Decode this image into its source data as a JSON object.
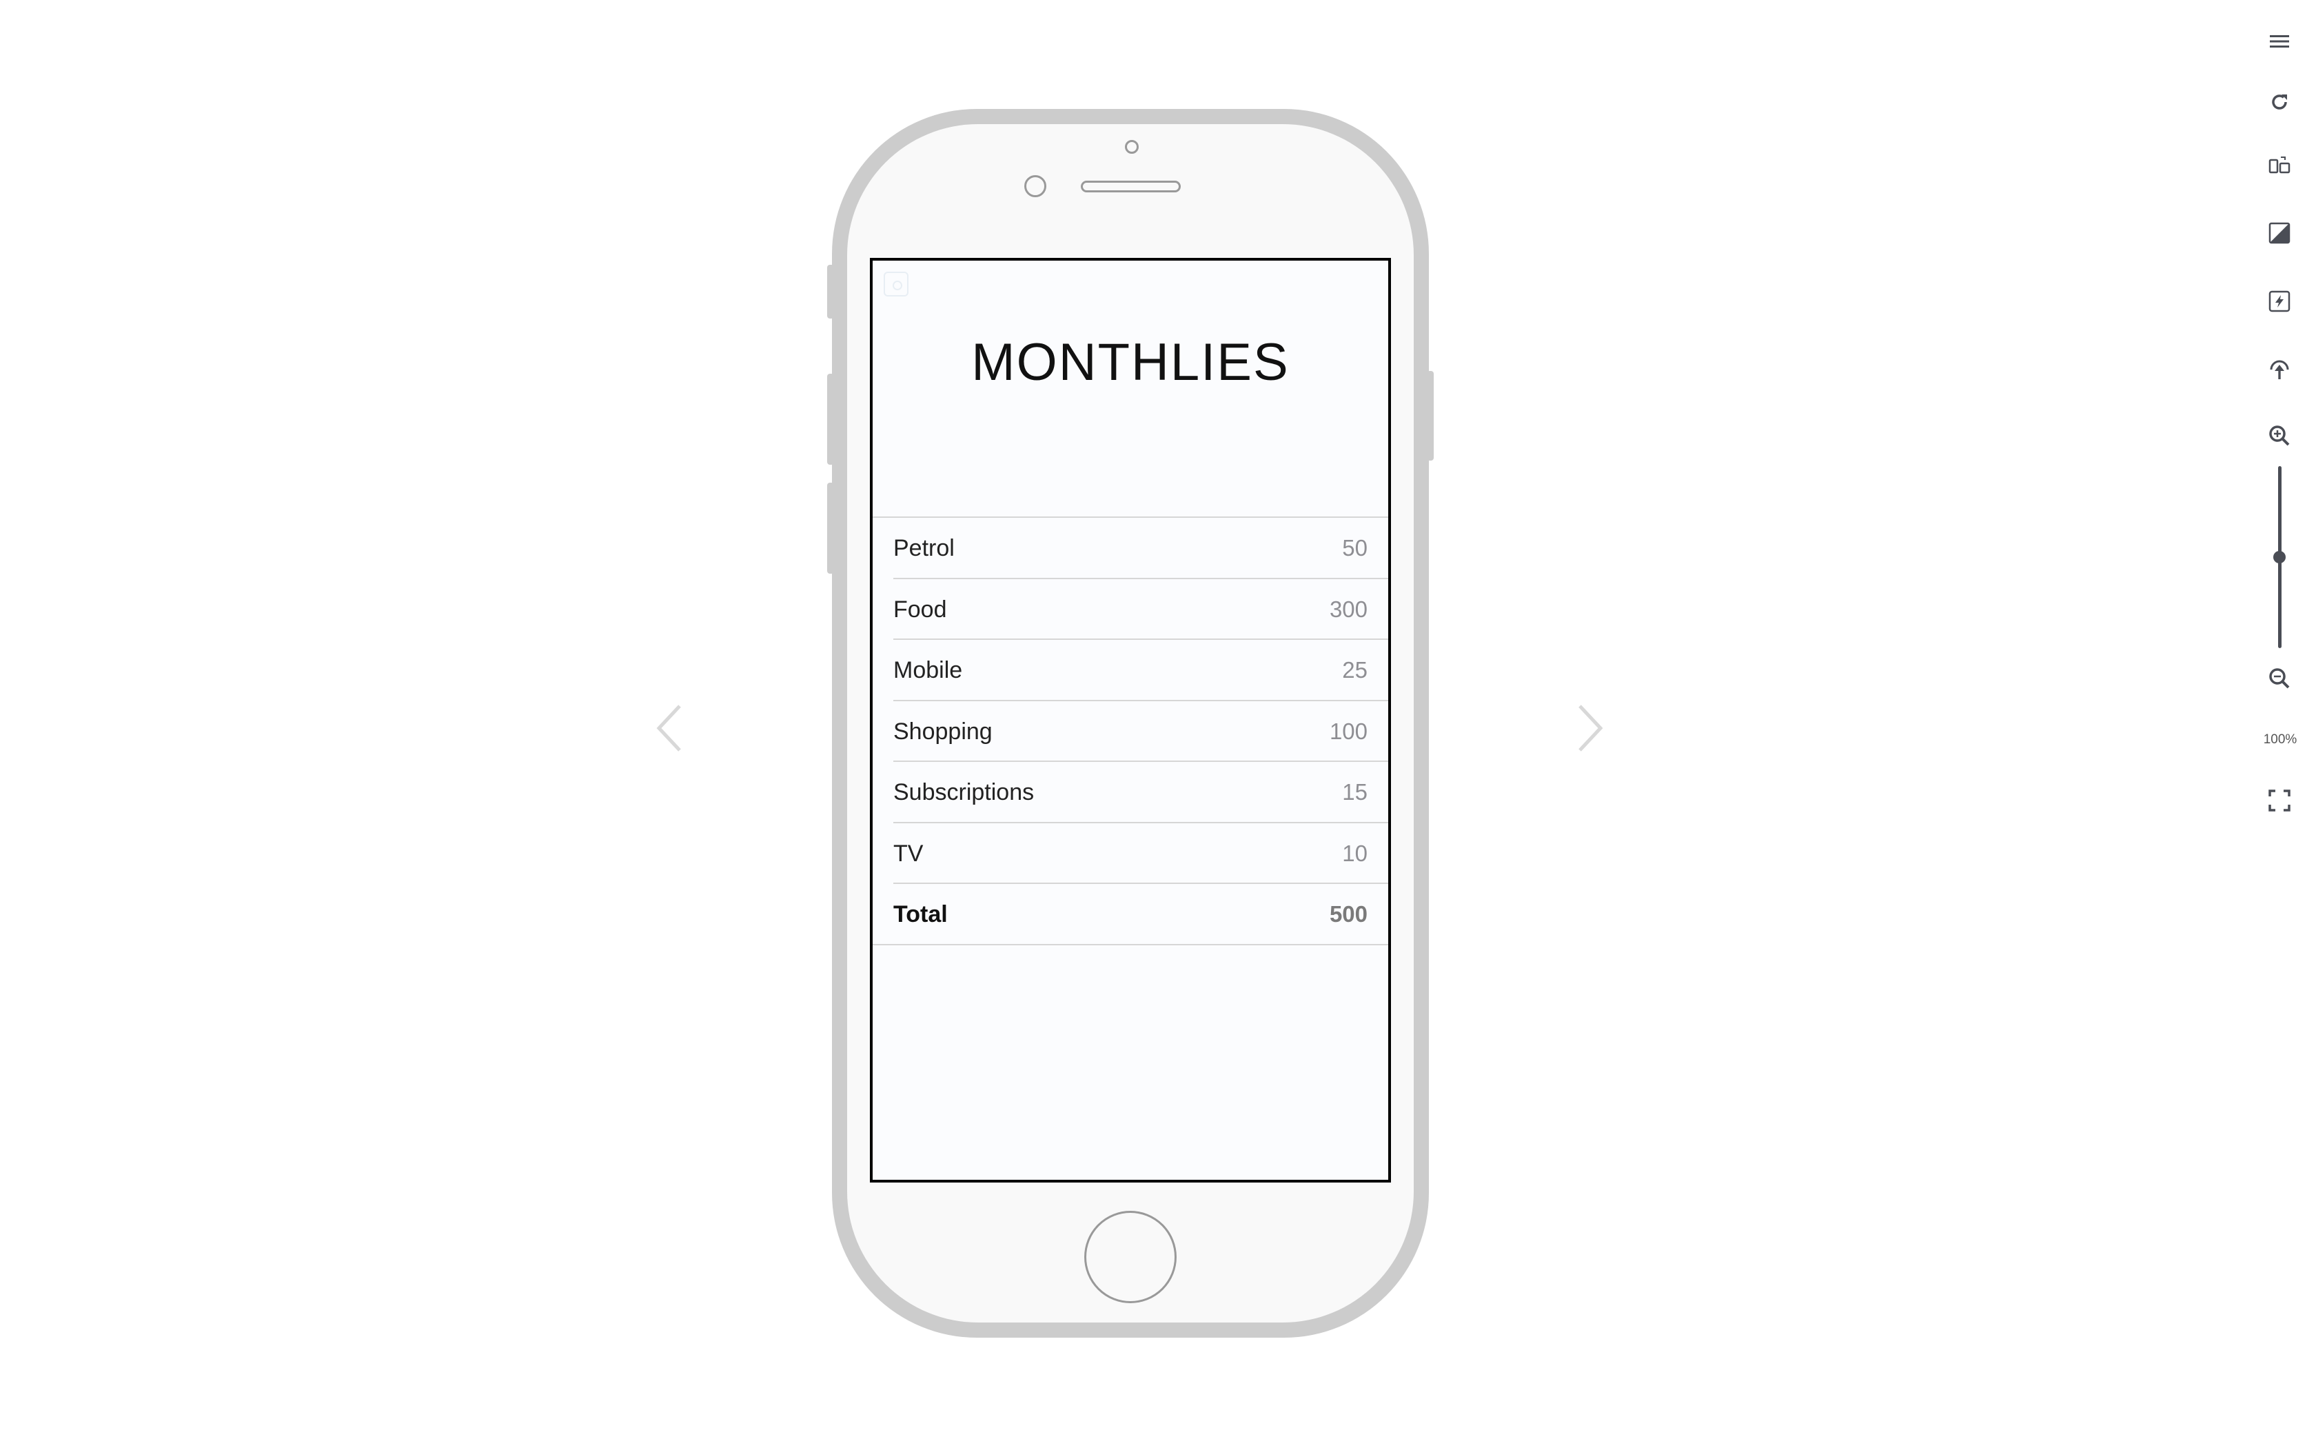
{
  "screen": {
    "title": "MONTHLIES",
    "items": [
      {
        "label": "Petrol",
        "value": "50"
      },
      {
        "label": "Food",
        "value": "300"
      },
      {
        "label": "Mobile",
        "value": "25"
      },
      {
        "label": "Shopping",
        "value": "100"
      },
      {
        "label": "Subscriptions",
        "value": "15"
      },
      {
        "label": "TV",
        "value": "10"
      }
    ],
    "total": {
      "label": "Total",
      "value": "500"
    }
  },
  "toolbar": {
    "icons": [
      "menu-icon",
      "refresh-icon",
      "rotate-device-icon",
      "contrast-icon",
      "flash-icon",
      "upload-icon",
      "zoom-in-icon",
      "zoom-out-icon",
      "fullscreen-icon"
    ],
    "zoom_label": "100%",
    "zoom_level": 0.5
  },
  "colors": {
    "toolbar_icon": "#4a4d55",
    "phone_frame": "#cccccc",
    "screen_bg": "#fbfcfe",
    "value_text": "#8e8e93"
  }
}
